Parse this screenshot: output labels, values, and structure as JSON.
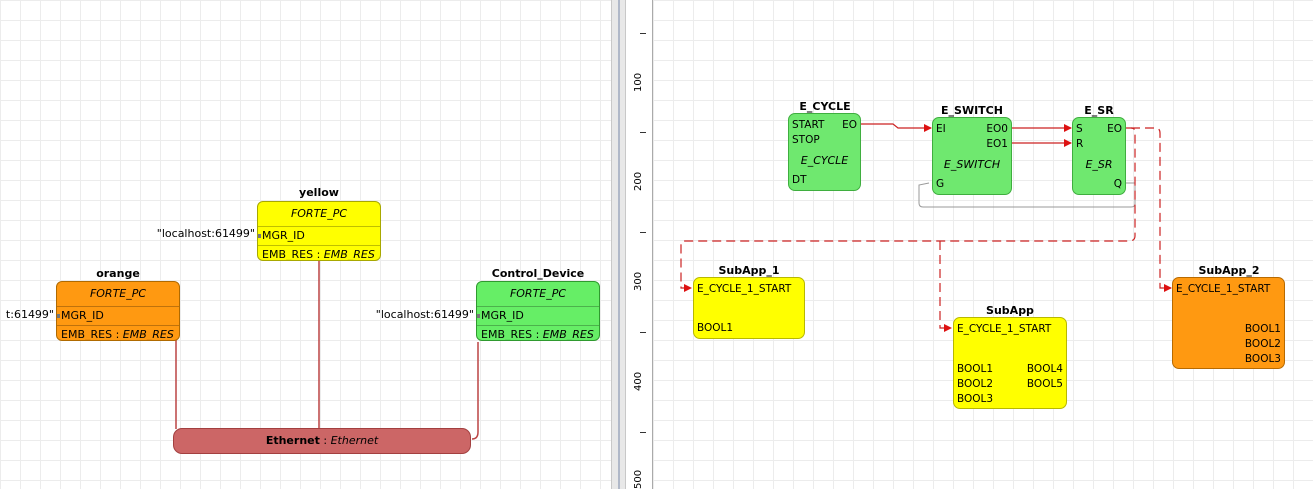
{
  "system_view": {
    "network": {
      "name": "Ethernet",
      "type": "Ethernet",
      "color": "#cc6666"
    },
    "devices": [
      {
        "id": "yellow",
        "title": "yellow",
        "type": "FORTE_PC",
        "param_value": "\"localhost:61499\"",
        "param": "MGR_ID",
        "resource": "EMB_RES",
        "resource_type": "EMB_RES",
        "color": "#ffff00"
      },
      {
        "id": "orange",
        "title": "orange",
        "type": "FORTE_PC",
        "param_value": "t:61499\"",
        "param": "MGR_ID",
        "resource": "EMB_RES",
        "resource_type": "EMB_RES",
        "color": "#ff9911"
      },
      {
        "id": "control",
        "title": "Control_Device",
        "type": "FORTE_PC",
        "param_value": "\"localhost:61499\"",
        "param": "MGR_ID",
        "resource": "EMB_RES",
        "resource_type": "EMB_RES",
        "color": "#66ee66"
      }
    ]
  },
  "ruler": {
    "labels": [
      "100",
      "200",
      "300",
      "400",
      "500"
    ]
  },
  "application_view": {
    "blocks": [
      {
        "id": "e_cycle",
        "title": "E_CYCLE",
        "type": "E_CYCLE",
        "inputs": [
          "START",
          "STOP"
        ],
        "outputs": [
          "EO"
        ],
        "data_inputs": [
          "DT"
        ],
        "color": "#6fe86f"
      },
      {
        "id": "e_switch",
        "title": "E_SWITCH",
        "type": "E_SWITCH",
        "inputs": [
          "EI"
        ],
        "outputs": [
          "EO0",
          "EO1"
        ],
        "data_inputs": [
          "G"
        ],
        "color": "#6fe86f"
      },
      {
        "id": "e_sr",
        "title": "E_SR",
        "type": "E_SR",
        "inputs": [
          "S",
          "R"
        ],
        "outputs": [
          "EO"
        ],
        "data_outputs": [
          "Q"
        ],
        "color": "#6fe86f"
      },
      {
        "id": "subapp1",
        "title": "SubApp_1",
        "inputs": [
          "E_CYCLE_1_START"
        ],
        "data_inputs": [
          "BOOL1"
        ],
        "color": "#ffff00"
      },
      {
        "id": "subapp",
        "title": "SubApp",
        "inputs": [
          "E_CYCLE_1_START"
        ],
        "data_inputs": [
          "BOOL1",
          "BOOL2",
          "BOOL3"
        ],
        "data_outputs": [
          "BOOL4",
          "BOOL5"
        ],
        "color": "#ffff00"
      },
      {
        "id": "subapp2",
        "title": "SubApp_2",
        "inputs": [
          "E_CYCLE_1_START"
        ],
        "data_outputs": [
          "BOOL1",
          "BOOL2",
          "BOOL3"
        ],
        "color": "#ff9911"
      }
    ],
    "event_color": "#dd1111"
  }
}
